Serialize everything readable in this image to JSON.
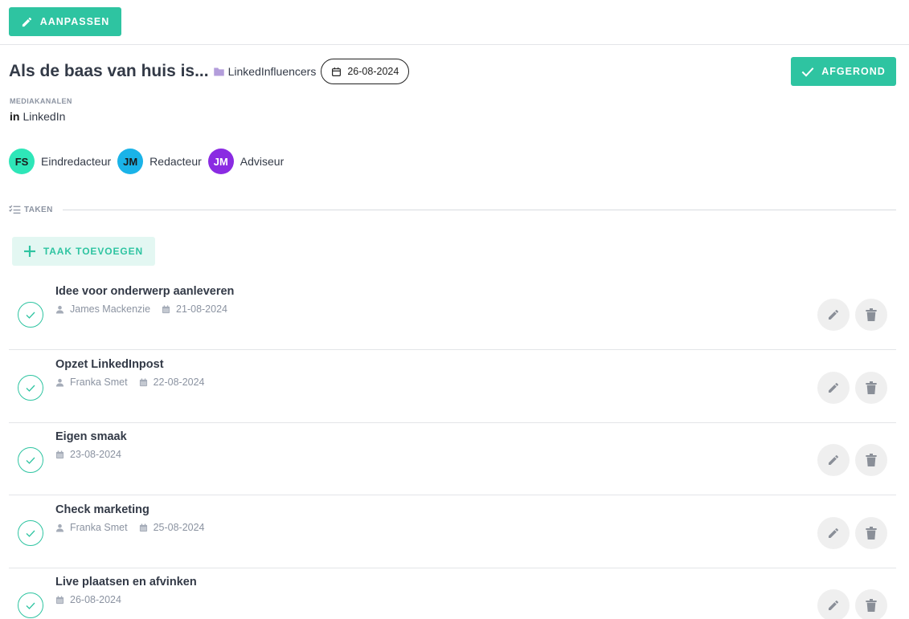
{
  "toolbar": {
    "edit_label": "AANPASSEN"
  },
  "header": {
    "title": "Als de baas van huis is...",
    "folder": "LinkedInfluencers",
    "date": "26-08-2024",
    "done_label": "AFGEROND"
  },
  "media": {
    "label": "MEDIAKANALEN",
    "channel_abbr": "in",
    "channel": "LinkedIn"
  },
  "people": [
    {
      "initials": "FS",
      "role": "Eindredacteur",
      "bg": "#2ee6b8",
      "fg": "#1a1a1a"
    },
    {
      "initials": "JM",
      "role": "Redacteur",
      "bg": "#1ab3e8",
      "fg": "#1a1a1a"
    },
    {
      "initials": "JM",
      "role": "Adviseur",
      "bg": "#8a2be2",
      "fg": "#ffffff"
    }
  ],
  "tasks_section": {
    "label": "TAKEN",
    "add_label": "TAAK TOEVOEGEN"
  },
  "tasks": [
    {
      "title": "Idee voor onderwerp aanleveren",
      "assignee": "James Mackenzie",
      "date": "21-08-2024"
    },
    {
      "title": "Opzet LinkedInpost",
      "assignee": "Franka Smet",
      "date": "22-08-2024"
    },
    {
      "title": "Eigen smaak",
      "assignee": "",
      "date": "23-08-2024"
    },
    {
      "title": "Check marketing",
      "assignee": "Franka Smet",
      "date": "25-08-2024"
    },
    {
      "title": "Live plaatsen en afvinken",
      "assignee": "",
      "date": "26-08-2024"
    }
  ],
  "colors": {
    "accent": "#2ec4a1",
    "accent_light": "#e3f7f2",
    "folder": "#b39ddb",
    "muted": "#8b93a1"
  }
}
